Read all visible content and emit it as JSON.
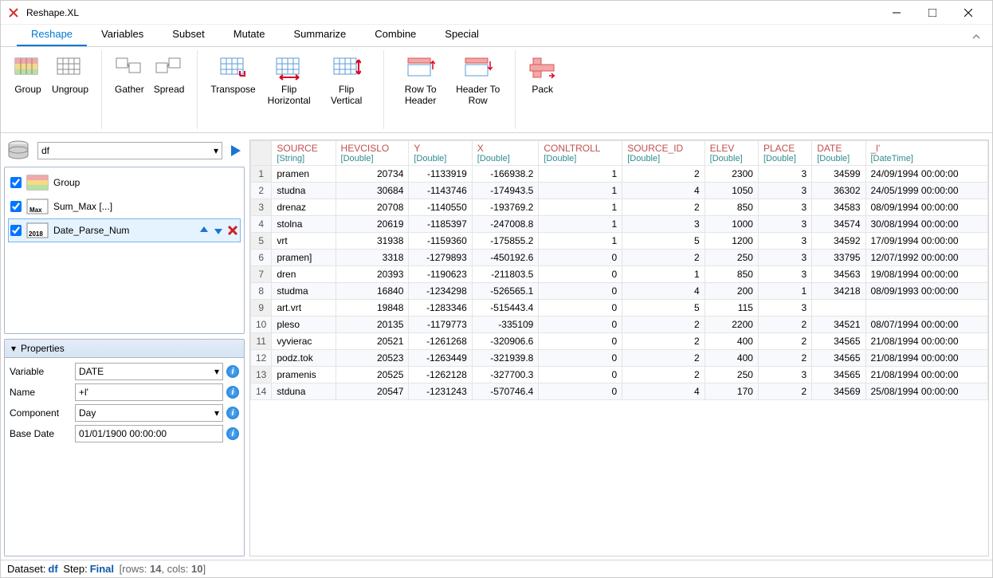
{
  "window": {
    "title": "Reshape.XL"
  },
  "menu": {
    "tabs": [
      "Reshape",
      "Variables",
      "Subset",
      "Mutate",
      "Summarize",
      "Combine",
      "Special"
    ],
    "active": 0
  },
  "ribbon": {
    "groups": [
      {
        "items": [
          {
            "id": "group",
            "label": "Group"
          },
          {
            "id": "ungroup",
            "label": "Ungroup"
          }
        ]
      },
      {
        "items": [
          {
            "id": "gather",
            "label": "Gather"
          },
          {
            "id": "spread",
            "label": "Spread"
          }
        ]
      },
      {
        "items": [
          {
            "id": "transpose",
            "label": "Transpose"
          },
          {
            "id": "fliph",
            "label": "Flip Horizontal"
          },
          {
            "id": "flipv",
            "label": "Flip Vertical"
          }
        ]
      },
      {
        "items": [
          {
            "id": "rowtoheader",
            "label": "Row To Header"
          },
          {
            "id": "headertorow",
            "label": "Header To Row"
          }
        ]
      },
      {
        "items": [
          {
            "id": "pack",
            "label": "Pack"
          }
        ]
      }
    ]
  },
  "dataset_selector": {
    "value": "df"
  },
  "steps": [
    {
      "checked": true,
      "label": "Group",
      "icon": "group",
      "selected": false
    },
    {
      "checked": true,
      "label": "Sum_Max [...]",
      "icon": "max",
      "selected": false
    },
    {
      "checked": true,
      "label": "Date_Parse_Num",
      "icon": "date",
      "selected": true
    }
  ],
  "properties": {
    "title": "Properties",
    "rows": {
      "variable_label": "Variable",
      "variable_value": "DATE",
      "name_label": "Name",
      "name_value": "+l'",
      "component_label": "Component",
      "component_value": "Day",
      "basedate_label": "Base Date",
      "basedate_value": "01/01/1900 00:00:00"
    }
  },
  "grid": {
    "columns": [
      {
        "name": "SOURCE",
        "type": "[String]",
        "align": "left"
      },
      {
        "name": "HEVCISLO",
        "type": "[Double]",
        "align": "right"
      },
      {
        "name": "Y",
        "type": "[Double]",
        "align": "right"
      },
      {
        "name": "X",
        "type": "[Double]",
        "align": "right"
      },
      {
        "name": "CONLTROLL",
        "type": "[Double]",
        "align": "right"
      },
      {
        "name": "SOURCE_ID",
        "type": "[Double]",
        "align": "right"
      },
      {
        "name": "ELEV",
        "type": "[Double]",
        "align": "right"
      },
      {
        "name": "PLACE",
        "type": "[Double]",
        "align": "right"
      },
      {
        "name": "DATE",
        "type": "[Double]",
        "align": "right"
      },
      {
        "name": "_l'",
        "type": "[DateTime]",
        "align": "left"
      }
    ],
    "rows": [
      [
        "pramen",
        "20734",
        "-1133919",
        "-166938.2",
        "1",
        "2",
        "2300",
        "3",
        "34599",
        "24/09/1994 00:00:00"
      ],
      [
        "studna",
        "30684",
        "-1143746",
        "-174943.5",
        "1",
        "4",
        "1050",
        "3",
        "36302",
        "24/05/1999 00:00:00"
      ],
      [
        "drenaz",
        "20708",
        "-1140550",
        "-193769.2",
        "1",
        "2",
        "850",
        "3",
        "34583",
        "08/09/1994 00:00:00"
      ],
      [
        "stolna",
        "20619",
        "-1185397",
        "-247008.8",
        "1",
        "3",
        "1000",
        "3",
        "34574",
        "30/08/1994 00:00:00"
      ],
      [
        "vrt",
        "31938",
        "-1159360",
        "-175855.2",
        "1",
        "5",
        "1200",
        "3",
        "34592",
        "17/09/1994 00:00:00"
      ],
      [
        "pramen]",
        "3318",
        "-1279893",
        "-450192.6",
        "0",
        "2",
        "250",
        "3",
        "33795",
        "12/07/1992 00:00:00"
      ],
      [
        "dren",
        "20393",
        "-1190623",
        "-211803.5",
        "0",
        "1",
        "850",
        "3",
        "34563",
        "19/08/1994 00:00:00"
      ],
      [
        "studma",
        "16840",
        "-1234298",
        "-526565.1",
        "0",
        "4",
        "200",
        "1",
        "34218",
        "08/09/1993 00:00:00"
      ],
      [
        "art.vrt",
        "19848",
        "-1283346",
        "-515443.4",
        "0",
        "5",
        "115",
        "3",
        "",
        ""
      ],
      [
        "pleso",
        "20135",
        "-1179773",
        "-335109",
        "0",
        "2",
        "2200",
        "2",
        "34521",
        "08/07/1994 00:00:00"
      ],
      [
        "vyvierac",
        "20521",
        "-1261268",
        "-320906.6",
        "0",
        "2",
        "400",
        "2",
        "34565",
        "21/08/1994 00:00:00"
      ],
      [
        "podz.tok",
        "20523",
        "-1263449",
        "-321939.8",
        "0",
        "2",
        "400",
        "2",
        "34565",
        "21/08/1994 00:00:00"
      ],
      [
        "pramenis",
        "20525",
        "-1262128",
        "-327700.3",
        "0",
        "2",
        "250",
        "3",
        "34565",
        "21/08/1994 00:00:00"
      ],
      [
        "stduna",
        "20547",
        "-1231243",
        "-570746.4",
        "0",
        "4",
        "170",
        "2",
        "34569",
        "25/08/1994 00:00:00"
      ]
    ]
  },
  "status": {
    "dataset_label": "Dataset:",
    "dataset_value": "df",
    "step_label": "Step:",
    "step_value": "Final",
    "rows_label": "rows:",
    "rows_value": "14",
    "cols_label": "cols:",
    "cols_value": "10"
  }
}
